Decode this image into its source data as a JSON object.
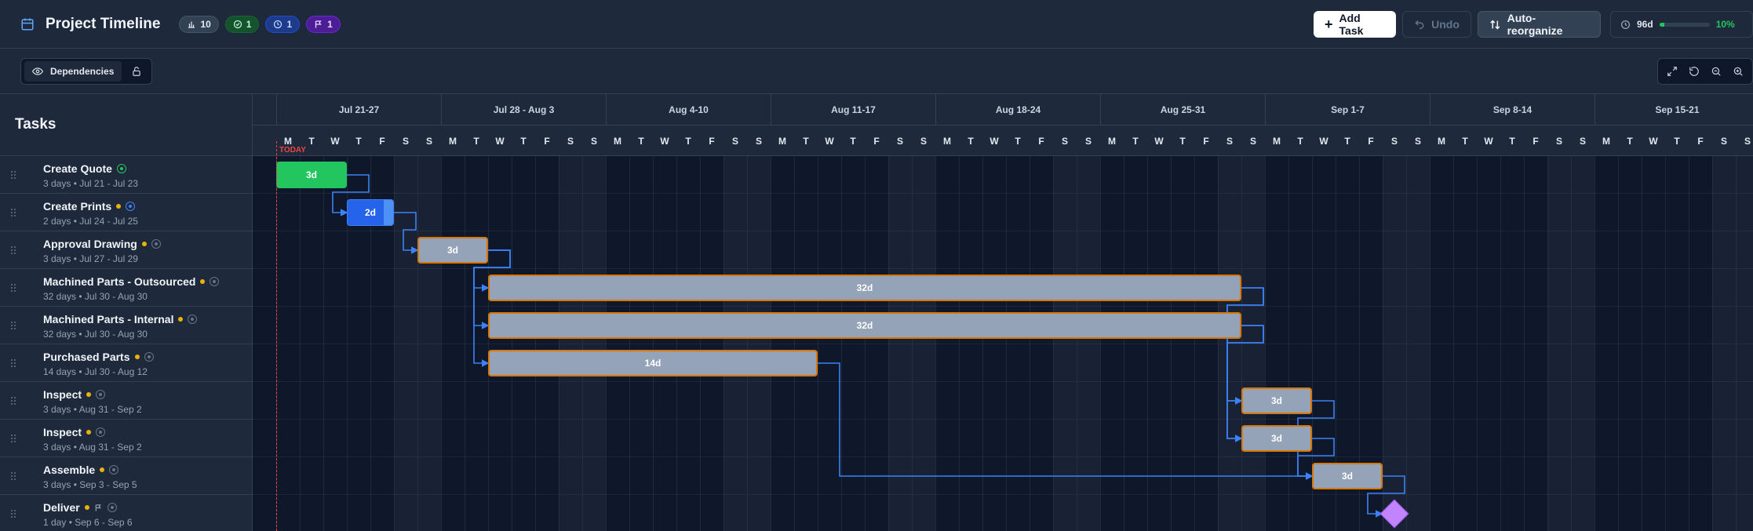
{
  "header": {
    "title": "Project Timeline",
    "badges": [
      {
        "label": "10",
        "icon": "bar-chart-icon"
      },
      {
        "label": "1",
        "icon": "check-circle-icon"
      },
      {
        "label": "1",
        "icon": "clock-icon"
      },
      {
        "label": "1",
        "icon": "flag-icon"
      }
    ],
    "add_task": "Add Task",
    "undo": "Undo",
    "auto_reorganize": "Auto-reorganize",
    "duration": "96d",
    "progress_pct": "10%",
    "progress_value": 0.1
  },
  "toolbar": {
    "dependencies": "Dependencies"
  },
  "sidebar": {
    "title": "Tasks",
    "tasks": [
      {
        "name": "Create Quote",
        "meta": "3 days • Jul 21 - Jul 23",
        "status": "done"
      },
      {
        "name": "Create Prints",
        "meta": "2 days • Jul 24 - Jul 25",
        "status": "progress"
      },
      {
        "name": "Approval Drawing",
        "meta": "3 days • Jul 27 - Jul 29",
        "status": "planned"
      },
      {
        "name": "Machined Parts - Outsourced",
        "meta": "32 days • Jul 30 - Aug 30",
        "status": "planned"
      },
      {
        "name": "Machined Parts - Internal",
        "meta": "32 days • Jul 30 - Aug 30",
        "status": "planned"
      },
      {
        "name": "Purchased Parts",
        "meta": "14 days • Jul 30 - Aug 12",
        "status": "planned"
      },
      {
        "name": "Inspect",
        "meta": "3 days • Aug 31 - Sep 2",
        "status": "planned"
      },
      {
        "name": "Inspect",
        "meta": "3 days • Aug 31 - Sep 2",
        "status": "planned"
      },
      {
        "name": "Assemble",
        "meta": "3 days • Sep 3 - Sep 5",
        "status": "planned"
      },
      {
        "name": "Deliver",
        "meta": "1 day • Sep 6 - Sep 6",
        "status": "milestone"
      }
    ]
  },
  "timeline": {
    "today_label": "TODAY",
    "weeks": [
      "Jul 21-27",
      "Jul 28 - Aug 3",
      "Aug 4-10",
      "Aug 11-17",
      "Aug 18-24",
      "Aug 25-31",
      "Sep 1-7",
      "Sep 8-14",
      "Sep 15-21"
    ],
    "day_letters": [
      "M",
      "T",
      "W",
      "T",
      "F",
      "S",
      "S"
    ],
    "bars": [
      {
        "label": "3d",
        "kind": "done"
      },
      {
        "label": "2d",
        "kind": "prog"
      },
      {
        "label": "3d",
        "kind": "plan"
      },
      {
        "label": "32d",
        "kind": "plan"
      },
      {
        "label": "32d",
        "kind": "plan"
      },
      {
        "label": "14d",
        "kind": "plan"
      },
      {
        "label": "3d",
        "kind": "plan"
      },
      {
        "label": "3d",
        "kind": "plan"
      },
      {
        "label": "3d",
        "kind": "plan"
      }
    ]
  },
  "colors": {
    "done": "#22c55e",
    "progress": "#2563eb",
    "planned": "#94a3b8",
    "milestone": "#c084fc",
    "today": "#ef4444",
    "dependency": "#3b82f6"
  }
}
